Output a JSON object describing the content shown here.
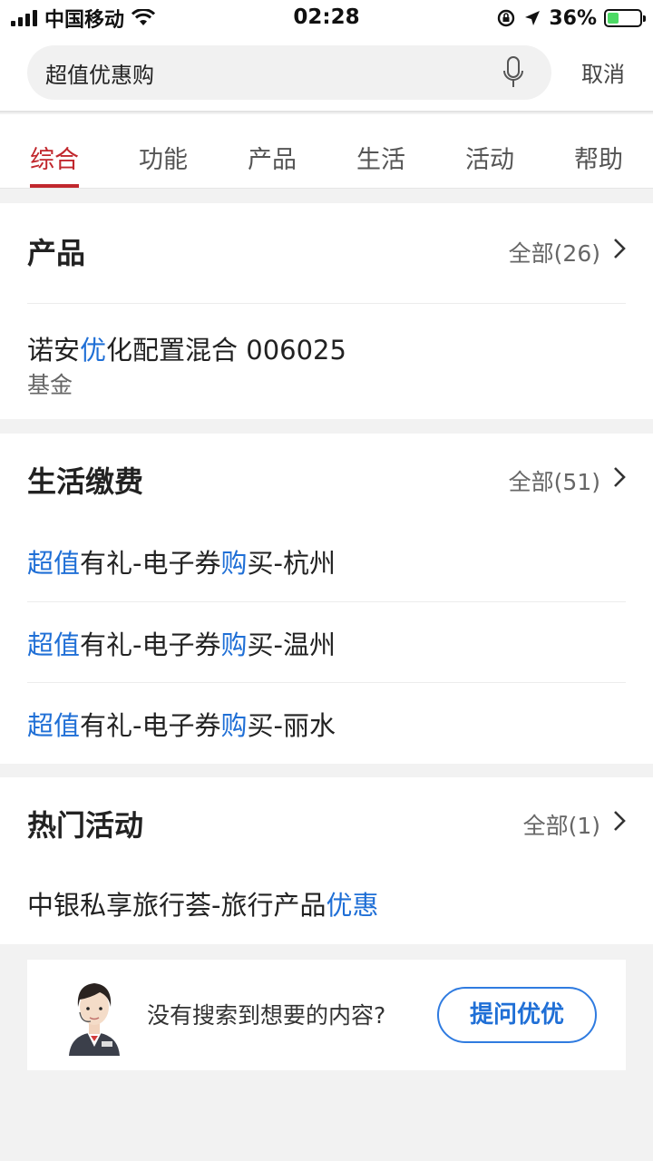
{
  "status_bar": {
    "carrier": "中国移动",
    "time": "02:28",
    "battery": "36%",
    "battery_level": 0.36
  },
  "search": {
    "value": "超值优惠购",
    "cancel_label": "取消"
  },
  "tabs": [
    {
      "label": "综合",
      "active": true
    },
    {
      "label": "功能",
      "active": false
    },
    {
      "label": "产品",
      "active": false
    },
    {
      "label": "生活",
      "active": false
    },
    {
      "label": "活动",
      "active": false
    },
    {
      "label": "帮助",
      "active": false
    }
  ],
  "products": {
    "title": "产品",
    "all_label": "全部(26)",
    "item": {
      "name_pre": "诺安",
      "name_hl": "优",
      "name_post": "化配置混合 006025",
      "type": "基金"
    }
  },
  "life": {
    "title": "生活缴费",
    "all_label": "全部(51)",
    "items": [
      {
        "hl1": "超值",
        "mid": "有礼-电子券",
        "hl2": "购",
        "post": "买-杭州"
      },
      {
        "hl1": "超值",
        "mid": "有礼-电子券",
        "hl2": "购",
        "post": "买-温州"
      },
      {
        "hl1": "超值",
        "mid": "有礼-电子券",
        "hl2": "购",
        "post": "买-丽水"
      }
    ]
  },
  "activities": {
    "title": "热门活动",
    "all_label": "全部(1)",
    "item": {
      "pre": "中银私享旅行荟-旅行产品",
      "hl": "优惠"
    }
  },
  "help": {
    "text": "没有搜索到想要的内容?",
    "button_label": "提问优优"
  },
  "colors": {
    "accent": "#c1272d",
    "highlight": "#1f6fd6"
  }
}
